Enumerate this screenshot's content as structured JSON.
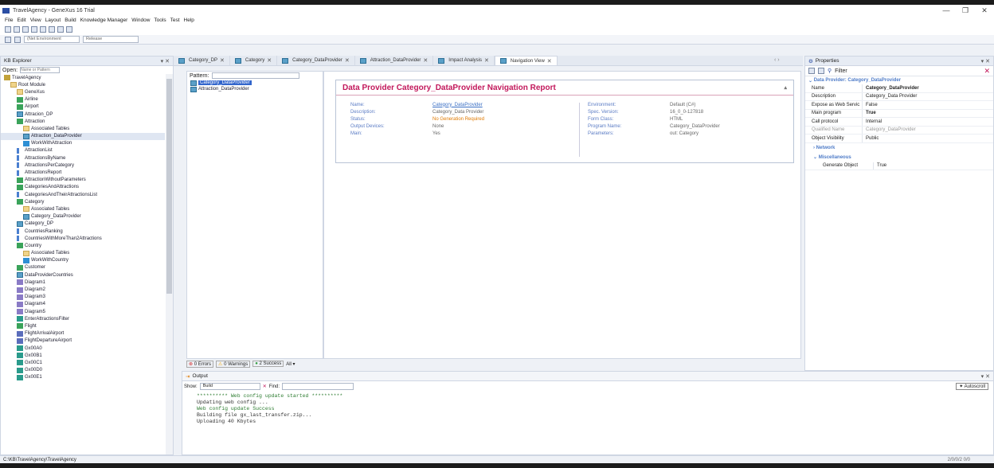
{
  "window": {
    "title": "TravelAgency - GeneXus 16 Trial",
    "minimize": "—",
    "maximize": "❐",
    "close": "✕"
  },
  "menu": [
    "File",
    "Edit",
    "View",
    "Layout",
    "Build",
    "Knowledge Manager",
    "Window",
    "Tools",
    "Test",
    "Help"
  ],
  "toolbar2": {
    "environment": "(Net Environment",
    "config": "Release"
  },
  "kb": {
    "title": "KB Explorer",
    "open_label": "Open:",
    "open_placeholder": "Name or Pattern",
    "items": [
      {
        "label": "TravelAgency",
        "icon": "root"
      },
      {
        "label": "Root Module",
        "icon": "folder"
      },
      {
        "label": "GeneXus",
        "icon": "folder"
      },
      {
        "label": "Airline",
        "icon": "trn"
      },
      {
        "label": "Airport",
        "icon": "trn"
      },
      {
        "label": "Attracion_DP",
        "icon": "dp"
      },
      {
        "label": "Attraction",
        "icon": "trn"
      },
      {
        "label": "Associated Tables",
        "icon": "folder"
      },
      {
        "label": "Attraction_DataProvider",
        "icon": "dp"
      },
      {
        "label": "WorkWithAttraction",
        "icon": "wwp"
      },
      {
        "label": "AttractionList",
        "icon": "proc"
      },
      {
        "label": "AttractionsByName",
        "icon": "proc"
      },
      {
        "label": "AttractionsPerCategory",
        "icon": "proc"
      },
      {
        "label": "AttractionsReport",
        "icon": "proc"
      },
      {
        "label": "AttractionWithoutParameters",
        "icon": "trn"
      },
      {
        "label": "CategoriesAndAttractions",
        "icon": "trn"
      },
      {
        "label": "CategoriesAndTheirAttractionsList",
        "icon": "proc"
      },
      {
        "label": "Category",
        "icon": "trn"
      },
      {
        "label": "Associated Tables",
        "icon": "folder"
      },
      {
        "label": "Category_DataProvider",
        "icon": "dp"
      },
      {
        "label": "Category_DP",
        "icon": "dp"
      },
      {
        "label": "CountriesRanking",
        "icon": "proc"
      },
      {
        "label": "CountriesWithMoreThan2Attractions",
        "icon": "proc"
      },
      {
        "label": "Country",
        "icon": "trn"
      },
      {
        "label": "Associated Tables",
        "icon": "folder"
      },
      {
        "label": "WorkWithCountry",
        "icon": "wwp"
      },
      {
        "label": "Customer",
        "icon": "trn"
      },
      {
        "label": "DataProviderCountries",
        "icon": "dp"
      },
      {
        "label": "Diagram1",
        "icon": "diag"
      },
      {
        "label": "Diagram2",
        "icon": "diag"
      },
      {
        "label": "Diagram3",
        "icon": "diag"
      },
      {
        "label": "Diagram4",
        "icon": "diag"
      },
      {
        "label": "Diagram5",
        "icon": "diag"
      },
      {
        "label": "EnterAttractionsFilter",
        "icon": "panel"
      },
      {
        "label": "Flight",
        "icon": "trn"
      },
      {
        "label": "FlightArrivalAirport",
        "icon": "lines"
      },
      {
        "label": "FlightDepartureAirport",
        "icon": "lines"
      },
      {
        "label": "Gx00A0",
        "icon": "panel"
      },
      {
        "label": "Gx00B1",
        "icon": "panel"
      },
      {
        "label": "Gx00C1",
        "icon": "panel"
      },
      {
        "label": "Gx00D0",
        "icon": "panel"
      },
      {
        "label": "Gx00E1",
        "icon": "panel"
      }
    ]
  },
  "tabs": [
    {
      "label": "Category_DP"
    },
    {
      "label": "Category"
    },
    {
      "label": "Category_DataProvider"
    },
    {
      "label": "Attraction_DataProvider"
    },
    {
      "label": "Impact Analysis"
    },
    {
      "label": "Navigation View"
    }
  ],
  "nav": {
    "pattern_label": "Pattern:",
    "items": [
      {
        "label": "Category_DataProvider"
      },
      {
        "label": "Attraction_DataProvider"
      }
    ],
    "errors": "0 Errors",
    "warnings": "0 Warnings",
    "success": "2 Success",
    "all": "All ▾"
  },
  "report": {
    "title": "Data Provider Category_DataProvider Navigation Report",
    "left": [
      {
        "k": "Name:",
        "v": "Category_DataProvider"
      },
      {
        "k": "Description:",
        "v": "Category_Data Provider"
      },
      {
        "k": "Status:",
        "v": "No Generation Required"
      },
      {
        "k": "Output Devices:",
        "v": "None"
      },
      {
        "k": "Main:",
        "v": "Yes"
      }
    ],
    "right": [
      {
        "k": "Environment:",
        "v": "Default (C#)"
      },
      {
        "k": "Spec. Version:",
        "v": "16_0_0-127818"
      },
      {
        "k": "Form Class:",
        "v": "HTML"
      },
      {
        "k": "Program Name:",
        "v": "Category_DataProvider"
      },
      {
        "k": "Parameters:",
        "v": "out: Category"
      }
    ]
  },
  "props": {
    "title": "Properties",
    "filter": "Filter",
    "section": "Data Provider: Category_DataProvider",
    "rows": [
      {
        "k": "Name",
        "v": "Category_DataProvider"
      },
      {
        "k": "Description",
        "v": "Category_Data Provider"
      },
      {
        "k": "Expose as Web Servic",
        "v": "False"
      },
      {
        "k": "Main program",
        "v": "True"
      },
      {
        "k": "Call protocol",
        "v": "Internal"
      },
      {
        "k": "Qualified Name",
        "v": "Category_DataProvider"
      },
      {
        "k": "Object Visibility",
        "v": "Public"
      }
    ],
    "network": "Network",
    "misc": "Miscellaneous",
    "generate": {
      "k": "Generate Object",
      "v": "True"
    }
  },
  "output": {
    "title": "Output",
    "show_label": "Show:",
    "show_value": "Build",
    "find_label": "Find:",
    "autoscroll": "Autoscroll",
    "lines": [
      "********** Web config update started **********",
      "Updating web config ...",
      "Web config update Success",
      "Building file gx_last_transfer.zip...",
      "Uploading 40 Kbytes"
    ]
  },
  "status": {
    "path": "C:\\KB\\TravelAgency\\TravelAgency",
    "right": "2/0/0/2  0/0"
  }
}
